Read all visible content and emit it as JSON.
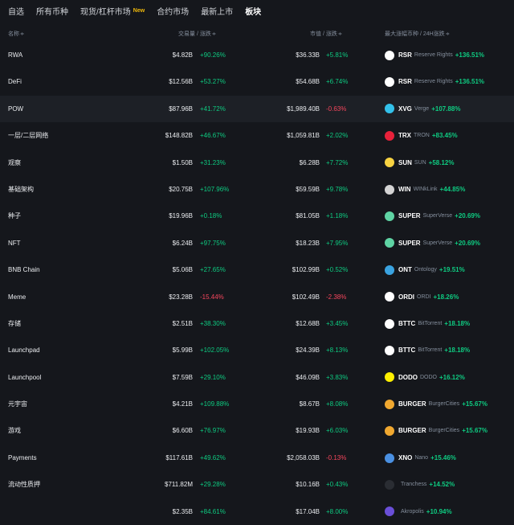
{
  "tabs": [
    {
      "label": "自选",
      "active": false
    },
    {
      "label": "所有币种",
      "active": false
    },
    {
      "label": "现货/杠杆市场",
      "active": false,
      "badge": "New"
    },
    {
      "label": "合约市场",
      "active": false
    },
    {
      "label": "最新上市",
      "active": false
    },
    {
      "label": "板块",
      "active": true
    }
  ],
  "columns": {
    "name": "名称",
    "volume": "交易量",
    "volume_change": "/ 涨跌",
    "market_cap": "市值",
    "cap_change": "/ 涨跌",
    "top_gainer": "最大涨幅币种 / 24H涨跌",
    "sort_icon": "≑"
  },
  "colors": {
    "positive": "#0ecb81",
    "negative": "#f6465d",
    "accent": "#f0b90b",
    "background": "#15171c"
  },
  "rows": [
    {
      "name": "RWA",
      "volume": "$4.82B",
      "volume_change": "+90.26%",
      "market_cap": "$36.33B",
      "cap_change": "+5.81%",
      "coin": {
        "symbol": "RSR",
        "name": "Reserve Rights",
        "change": "+136.51%",
        "icon": "rsr-icon",
        "color": "#ffffff"
      }
    },
    {
      "name": "DeFi",
      "volume": "$12.56B",
      "volume_change": "+53.27%",
      "market_cap": "$54.68B",
      "cap_change": "+6.74%",
      "coin": {
        "symbol": "RSR",
        "name": "Reserve Rights",
        "change": "+136.51%",
        "icon": "rsr-icon",
        "color": "#ffffff"
      }
    },
    {
      "name": "POW",
      "volume": "$87.96B",
      "volume_change": "+41.72%",
      "market_cap": "$1,989.40B",
      "cap_change": "-0.63%",
      "coin": {
        "symbol": "XVG",
        "name": "Verge",
        "change": "+107.88%",
        "icon": "verge-icon",
        "color": "#33c1ea"
      }
    },
    {
      "name": "一层/二层网络",
      "volume": "$148.82B",
      "volume_change": "+46.67%",
      "market_cap": "$1,059.81B",
      "cap_change": "+2.02%",
      "coin": {
        "symbol": "TRX",
        "name": "TRON",
        "change": "+83.45%",
        "icon": "tron-icon",
        "color": "#e8213a"
      }
    },
    {
      "name": "观察",
      "volume": "$1.50B",
      "volume_change": "+31.23%",
      "market_cap": "$6.28B",
      "cap_change": "+7.72%",
      "coin": {
        "symbol": "SUN",
        "name": "SUN",
        "change": "+58.12%",
        "icon": "sun-icon",
        "color": "#f8d342"
      }
    },
    {
      "name": "基础架构",
      "volume": "$20.75B",
      "volume_change": "+107.96%",
      "market_cap": "$59.59B",
      "cap_change": "+9.78%",
      "coin": {
        "symbol": "WIN",
        "name": "WINkLink",
        "change": "+44.85%",
        "icon": "winklink-icon",
        "color": "#d4d4d4"
      }
    },
    {
      "name": "种子",
      "volume": "$19.96B",
      "volume_change": "+0.18%",
      "market_cap": "$81.05B",
      "cap_change": "+1.18%",
      "coin": {
        "symbol": "SUPER",
        "name": "SuperVerse",
        "change": "+20.69%",
        "icon": "superverse-icon",
        "color": "#5fd4a4"
      }
    },
    {
      "name": "NFT",
      "volume": "$6.24B",
      "volume_change": "+97.75%",
      "market_cap": "$18.23B",
      "cap_change": "+7.95%",
      "coin": {
        "symbol": "SUPER",
        "name": "SuperVerse",
        "change": "+20.69%",
        "icon": "superverse-icon",
        "color": "#5fd4a4"
      }
    },
    {
      "name": "BNB Chain",
      "volume": "$5.06B",
      "volume_change": "+27.65%",
      "market_cap": "$102.99B",
      "cap_change": "+0.52%",
      "coin": {
        "symbol": "ONT",
        "name": "Ontology",
        "change": "+19.51%",
        "icon": "ontology-icon",
        "color": "#3aa3e0"
      }
    },
    {
      "name": "Meme",
      "volume": "$23.28B",
      "volume_change": "-15.44%",
      "market_cap": "$102.49B",
      "cap_change": "-2.38%",
      "coin": {
        "symbol": "ORDI",
        "name": "ORDI",
        "change": "+18.26%",
        "icon": "ordi-icon",
        "color": "#ffffff"
      }
    },
    {
      "name": "存储",
      "volume": "$2.51B",
      "volume_change": "+38.30%",
      "market_cap": "$12.68B",
      "cap_change": "+3.45%",
      "coin": {
        "symbol": "BTTC",
        "name": "BitTorrent",
        "change": "+18.18%",
        "icon": "bittorrent-icon",
        "color": "#ffffff"
      }
    },
    {
      "name": "Launchpad",
      "volume": "$5.99B",
      "volume_change": "+102.05%",
      "market_cap": "$24.39B",
      "cap_change": "+8.13%",
      "coin": {
        "symbol": "BTTC",
        "name": "BitTorrent",
        "change": "+18.18%",
        "icon": "bittorrent-icon",
        "color": "#ffffff"
      }
    },
    {
      "name": "Launchpool",
      "volume": "$7.59B",
      "volume_change": "+29.10%",
      "market_cap": "$46.09B",
      "cap_change": "+3.83%",
      "coin": {
        "symbol": "DODO",
        "name": "DODO",
        "change": "+16.12%",
        "icon": "dodo-icon",
        "color": "#fff000"
      }
    },
    {
      "name": "元宇宙",
      "volume": "$4.21B",
      "volume_change": "+109.88%",
      "market_cap": "$8.67B",
      "cap_change": "+8.08%",
      "coin": {
        "symbol": "BURGER",
        "name": "BurgerCities",
        "change": "+15.67%",
        "icon": "burgercities-icon",
        "color": "#f0a830"
      }
    },
    {
      "name": "游戏",
      "volume": "$6.60B",
      "volume_change": "+76.97%",
      "market_cap": "$19.93B",
      "cap_change": "+6.03%",
      "coin": {
        "symbol": "BURGER",
        "name": "BurgerCities",
        "change": "+15.67%",
        "icon": "burgercities-icon",
        "color": "#f0a830"
      }
    },
    {
      "name": "Payments",
      "volume": "$117.61B",
      "volume_change": "+49.62%",
      "market_cap": "$2,058.03B",
      "cap_change": "-0.13%",
      "coin": {
        "symbol": "XNO",
        "name": "Nano",
        "change": "+15.46%",
        "icon": "nano-icon",
        "color": "#4a90e2"
      }
    },
    {
      "name": "流动性质押",
      "volume": "$711.82M",
      "volume_change": "+29.28%",
      "market_cap": "$10.16B",
      "cap_change": "+0.43%",
      "coin": {
        "symbol": "",
        "name": "Tranchess",
        "change": "+14.52%",
        "icon": "tranchess-icon",
        "color": "#2a2d33"
      }
    },
    {
      "name": "",
      "volume": "$2.35B",
      "volume_change": "+84.61%",
      "market_cap": "$17.04B",
      "cap_change": "+8.00%",
      "coin": {
        "symbol": "",
        "name": "Akropolis",
        "change": "+10.94%",
        "icon": "akropolis-icon",
        "color": "#6a4fd8"
      }
    }
  ]
}
